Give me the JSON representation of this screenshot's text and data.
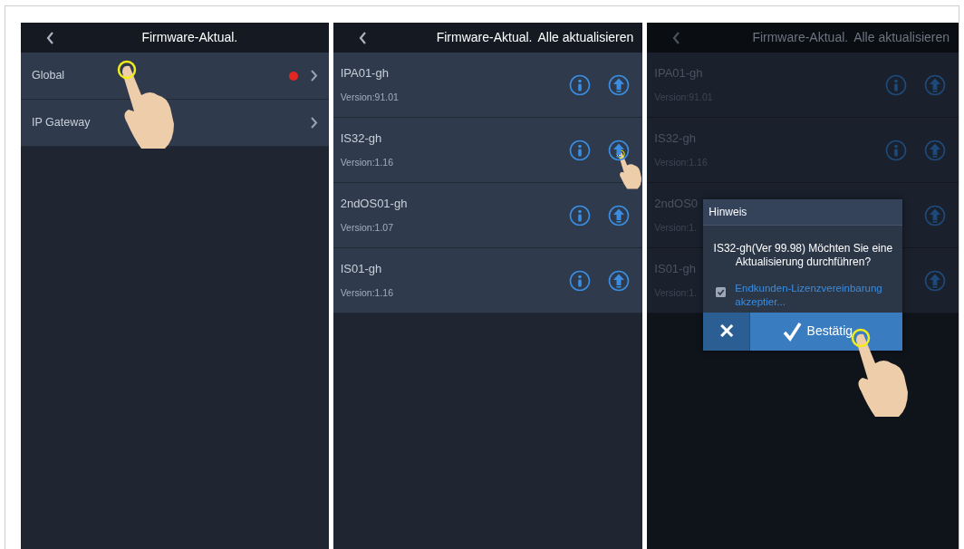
{
  "screens": [
    {
      "kind": "menu",
      "title": "Firmware-Aktual.",
      "dimmed": false,
      "items": [
        {
          "label": "Global",
          "notification": true,
          "tapped": true
        },
        {
          "label": "IP Gateway",
          "notification": false,
          "tapped": false
        }
      ]
    },
    {
      "kind": "devices",
      "title": "Firmware-Aktual.",
      "action": "Alle aktualisieren",
      "dimmed": false,
      "devices": [
        {
          "name": "IPA01-gh",
          "version": "Version:91.01",
          "buttons": [
            {
              "kind": "info",
              "tapped": false
            },
            {
              "kind": "update",
              "tapped": false
            }
          ]
        },
        {
          "name": "IS32-gh",
          "version": "Version:1.16",
          "buttons": [
            {
              "kind": "info",
              "tapped": false
            },
            {
              "kind": "update",
              "tapped": true
            }
          ]
        },
        {
          "name": "2ndOS01-gh",
          "version": "Version:1.07",
          "buttons": [
            {
              "kind": "info",
              "tapped": false
            },
            {
              "kind": "update",
              "tapped": false
            }
          ]
        },
        {
          "name": "IS01-gh",
          "version": "Version:1.16",
          "buttons": [
            {
              "kind": "info",
              "tapped": false
            },
            {
              "kind": "update",
              "tapped": false
            }
          ]
        }
      ]
    },
    {
      "kind": "devices",
      "title": "Firmware-Aktual.",
      "action": "Alle aktualisieren",
      "dimmed": true,
      "devices": [
        {
          "name": "IPA01-gh",
          "version": "Version:91.01",
          "buttons": [
            {
              "kind": "info",
              "tapped": false
            },
            {
              "kind": "update",
              "tapped": false
            }
          ]
        },
        {
          "name": "IS32-gh",
          "version": "Version:1.16",
          "buttons": [
            {
              "kind": "info",
              "tapped": false
            },
            {
              "kind": "update",
              "tapped": false
            }
          ]
        },
        {
          "name": "2ndOS0",
          "version": "Version:1.",
          "buttons": [
            {
              "kind": "update",
              "tapped": false
            }
          ]
        },
        {
          "name": "IS01-gh",
          "version": "Version:1.",
          "buttons": [
            {
              "kind": "update",
              "tapped": false
            }
          ]
        }
      ],
      "dialog": {
        "title": "Hinweis",
        "message": "IS32-gh(Ver 99.98) Möchten Sie eine Aktualisierung durchführen?",
        "checkbox": {
          "label": "Endkunden-Lizenzvereinbarung akzeptier...",
          "checked": true
        },
        "cancel": "✕",
        "confirm": {
          "label": "Bestätig",
          "tapped": true
        }
      }
    }
  ]
}
